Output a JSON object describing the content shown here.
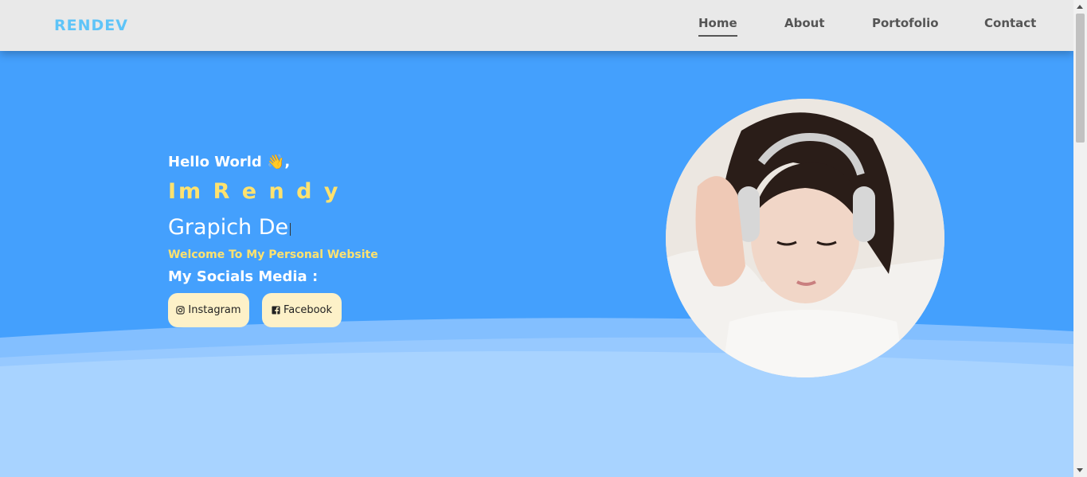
{
  "nav": {
    "brand": "RENDEV",
    "links": [
      "Home",
      "About",
      "Portofolio",
      "Contact"
    ],
    "active": "Home"
  },
  "hero": {
    "greeting": "Hello World 👋,",
    "name": "Im R e n d y",
    "role_typed": "Grapich De",
    "welcome": "Welcome To My Personal Website",
    "socials_title": "My Socials Media :",
    "instagram_label": "Instagram",
    "facebook_label": "Facebook"
  },
  "colors": {
    "hero_bg": "#44a0fd",
    "accent_yellow": "#ffe26e",
    "brand": "#5ec4f8",
    "button_bg": "#fdf1c8"
  },
  "icons": {
    "instagram": "instagram-icon",
    "facebook": "facebook-icon"
  }
}
